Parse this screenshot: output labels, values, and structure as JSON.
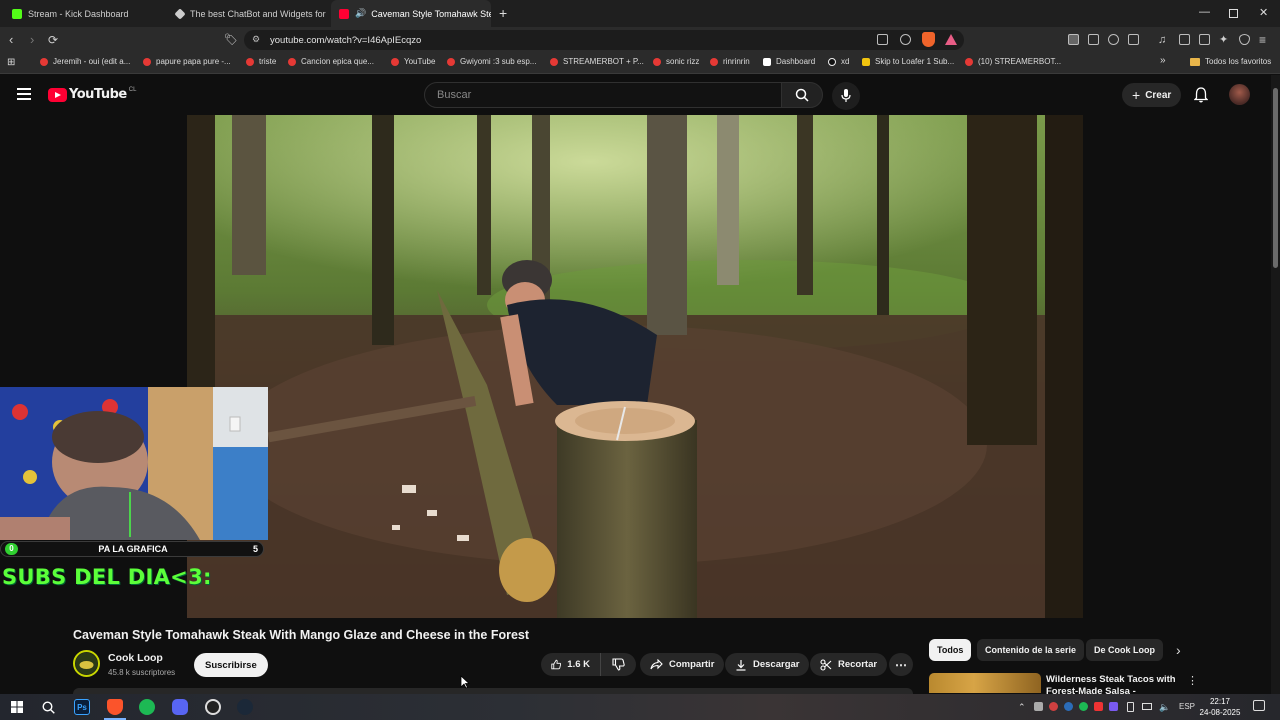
{
  "browser": {
    "tabs": [
      {
        "title": "Stream - Kick Dashboard",
        "fav_color": "#53fc18"
      },
      {
        "title": "The best ChatBot and Widgets for Ki",
        "fav_color": "#cccccc"
      },
      {
        "title": "Caveman Style Tomahawk Ste",
        "fav_color": "#ff0033"
      }
    ],
    "url": "youtube.com/watch?v=I46ApIEcqzo",
    "bookmarks": [
      "Jeremih - oui (edit a...",
      "papure papa pure -...",
      "triste",
      "Cancion epica que...",
      "YouTube",
      "Gwiyomi :3 sub esp...",
      "STREAMERBOT + P...",
      "sonic rizz",
      "rinrinrin",
      "Dashboard",
      "xd",
      "Skip to Loafer 1 Sub...",
      "(10) STREAMERBOT..."
    ],
    "all_favorites": "Todos los favoritos"
  },
  "youtube": {
    "logo_text": "YouTube",
    "logo_region": "CL",
    "search_placeholder": "Buscar",
    "create_label": "Crear"
  },
  "overlay": {
    "goal_count_left": "0",
    "goal_label": "PA LA GRAFICA",
    "goal_count_right": "5",
    "subs_text": "SUBS DEL DIA<3:"
  },
  "video": {
    "title": "Caveman Style Tomahawk Steak With Mango Glaze and Cheese in the Forest",
    "channel": "Cook Loop",
    "subscribers": "45.8 k suscriptores",
    "subscribe_label": "Suscribirse",
    "likes": "1.6 K",
    "share_label": "Compartir",
    "download_label": "Descargar",
    "clip_label": "Recortar"
  },
  "sidebar": {
    "chips": [
      "Todos",
      "Contenido de la serie",
      "De Cook Loop"
    ],
    "recommended_title": "Wilderness Steak Tacos with Forest-Made Salsa - PERFECT"
  },
  "taskbar": {
    "language": "ESP",
    "time": "22:17",
    "date": "24-08-2025"
  }
}
